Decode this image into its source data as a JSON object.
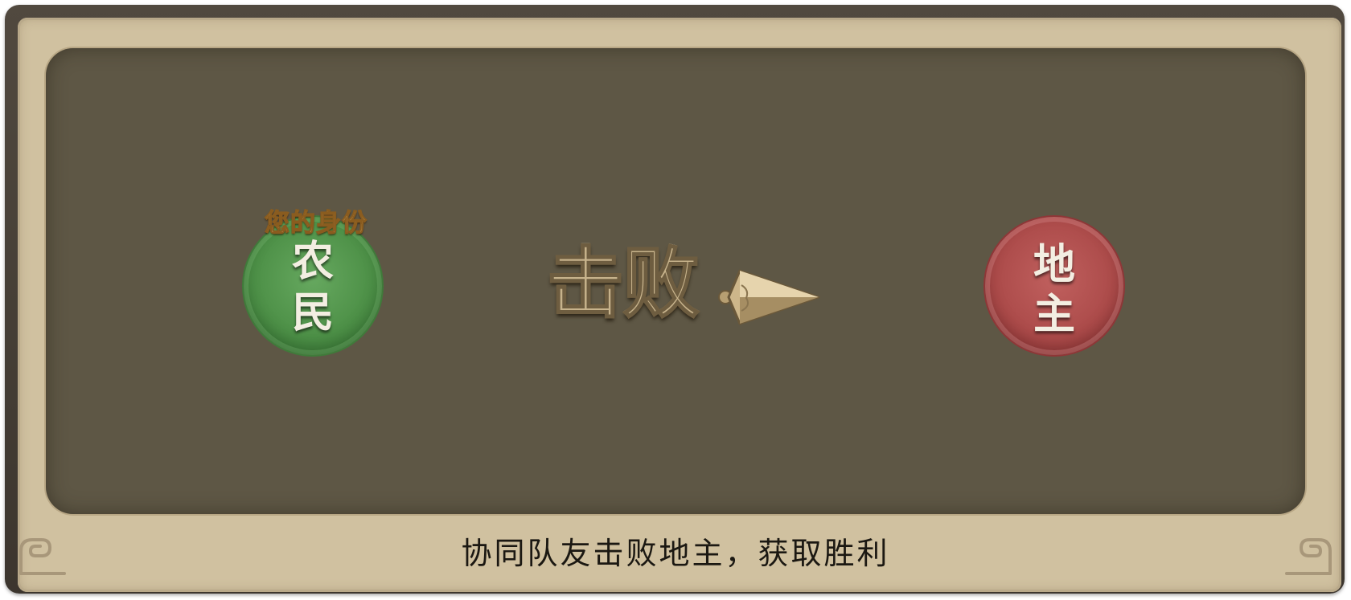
{
  "identity": {
    "caption": "您的身份",
    "role_line1": "农",
    "role_line2": "民"
  },
  "action": {
    "label": "击败"
  },
  "target": {
    "role_line1": "地",
    "role_line2": "主"
  },
  "hint": "协同队友击败地主，获取胜利",
  "colors": {
    "frame": "#d0c1a0",
    "panel": "#5e5745",
    "farmer_badge": "#4e9148",
    "landlord_badge": "#ad4c4b",
    "caption_gold": "#f6e2a6"
  },
  "icons": {
    "arrow": "arrowhead-icon",
    "corner": "corner-ornament-icon"
  }
}
